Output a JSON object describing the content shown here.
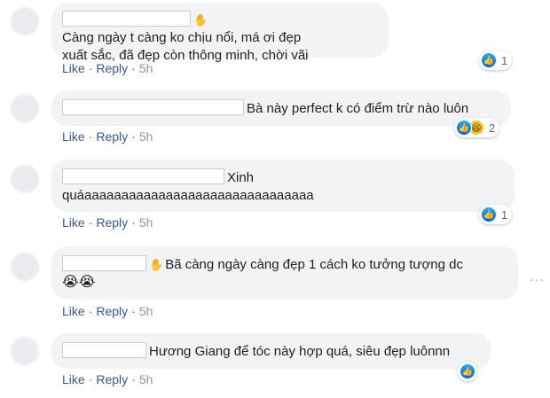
{
  "comments": [
    {
      "line1": "Càng ngày t càng ko chịu nổi, má ơi đẹp",
      "line2": "xuất sắc, đã đẹp còn thông minh, chời vãi",
      "reaction_count": "1"
    },
    {
      "line1": "Bà này perfect k có điểm trừ nào luôn",
      "reaction_count": "2"
    },
    {
      "line1": "Xinh",
      "line2": "quáaaaaaaaaaaaaaaaaaaaaaaaaaaaaaaa",
      "reaction_count": "1"
    },
    {
      "line1": "Bã càng ngày càng đẹp 1 cách ko tưởng tượng dc"
    },
    {
      "line1": "Hương Giang để tóc này hợp quá, siêu đẹp luônnn"
    }
  ],
  "actions": {
    "like": "Like",
    "reply": "Reply",
    "separator": "·",
    "time": "5h"
  },
  "icons": {
    "wave": "✋",
    "like": "👍",
    "haha": "😆",
    "cry": "😭😭",
    "more": "···"
  },
  "colors": {
    "link": "#385898",
    "bubble": "#f2f3f5",
    "like_blue": "#1877f2"
  }
}
